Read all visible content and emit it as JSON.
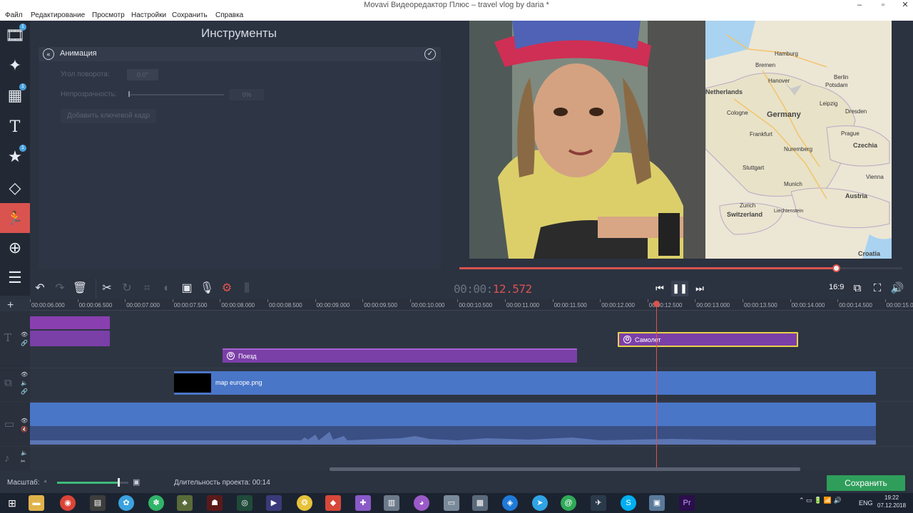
{
  "window": {
    "title": "Movavi Видеоредактор Плюс – travel vlog by daria *",
    "minimize": "–",
    "maximize": "▫",
    "close": "✕"
  },
  "menu": [
    "Файл",
    "Редактирование",
    "Просмотр",
    "Настройки",
    "Сохранить",
    "Справка"
  ],
  "left_tools": [
    {
      "icon": "video-import-icon",
      "glyph": "🎞",
      "badge": "1"
    },
    {
      "icon": "magic-wand-icon",
      "glyph": "✦"
    },
    {
      "icon": "filters-icon",
      "glyph": "▦",
      "badge": "1"
    },
    {
      "icon": "titles-icon",
      "glyph": "T"
    },
    {
      "icon": "stickers-icon",
      "glyph": "★",
      "badge": "1"
    },
    {
      "icon": "transitions-icon",
      "glyph": "◇"
    },
    {
      "icon": "animation-icon",
      "glyph": "🏃",
      "active": true
    },
    {
      "icon": "zoom-icon",
      "glyph": "⊕"
    },
    {
      "icon": "more-menu-icon",
      "glyph": "☰"
    }
  ],
  "tools_panel": {
    "title": "Инструменты",
    "section": "Анимация",
    "rotation_label": "Угол поворота:",
    "rotation_value": "0.0°",
    "opacity_label": "Непрозрачность:",
    "opacity_value": "0%",
    "add_keyframe": "Добавить ключевой кадр"
  },
  "preview": {
    "progress": 0.85,
    "map_labels": [
      "Hamburg",
      "Bremen",
      "Hanover",
      "Berlin",
      "Potsdam",
      "Leipzig",
      "Dresden",
      "Germany",
      "Cologne",
      "Frankfurt",
      "Prague",
      "Czechia",
      "Nuremberg",
      "Stuttgart",
      "Munich",
      "Vienna",
      "Austria",
      "Liechtenstein",
      "Switzerland",
      "Zurich",
      "Croatia",
      "Netherlands"
    ]
  },
  "edit_toolbar": {
    "icons": [
      "undo-icon",
      "redo-icon",
      "delete-icon",
      "cut-icon",
      "rotate-icon",
      "crop-icon",
      "color-adjust-icon",
      "image-icon",
      "microphone-icon",
      "settings-icon",
      "equalizer-icon"
    ]
  },
  "timecode": {
    "prefix": "00:00:",
    "value": "12.572"
  },
  "playback": {
    "prev": "⏮",
    "pause": "❚❚",
    "next": "⏭",
    "ratio": "16:9"
  },
  "ruler_ticks": [
    "00:00:06.000",
    "00:00:06.500",
    "00:00:07.000",
    "00:00:07.500",
    "00:00:08.000",
    "00:00:08.500",
    "00:00:09.000",
    "00:00:09.500",
    "00:00:10.000",
    "00:00:10.500",
    "00:00:11.000",
    "00:00:11.500",
    "00:00:12.000",
    "00:00:12.500",
    "00:00:13.000",
    "00:00:13.500",
    "00:00:14.000",
    "00:00:14.500",
    "00:00:15.0"
  ],
  "clips": {
    "train": "Поезд",
    "plane": "Самолет",
    "map": "map europe.png"
  },
  "status": {
    "zoom_label": "Масштаб:",
    "zoom_level": 0.86,
    "duration_label": "Длительность проекта:",
    "duration_value": "00:14",
    "save_button": "Сохранить"
  },
  "taskbar": {
    "lang": "ENG",
    "time": "19:22",
    "date": "07.12.2018"
  },
  "colors": {
    "accent": "#d9534f",
    "title_clip": "#7b3fa8",
    "overlay_clip": "#4a76c8",
    "save_green": "#2f9e5b"
  }
}
